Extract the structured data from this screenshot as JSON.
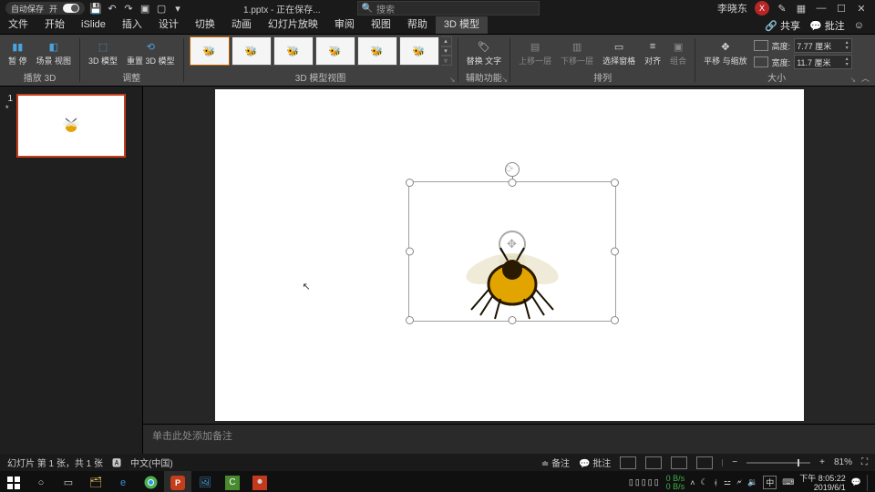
{
  "titlebar": {
    "autosave_label": "自动保存",
    "autosave_state": "开",
    "document": "1.pptx - 正在保存...",
    "search_placeholder": "搜索",
    "user_name": "李晓东",
    "user_initial": "X"
  },
  "tabs": {
    "items": [
      "文件",
      "开始",
      "iSlide",
      "插入",
      "设计",
      "切换",
      "动画",
      "幻灯片放映",
      "审阅",
      "视图",
      "帮助",
      "3D 模型"
    ],
    "active": "3D 模型",
    "share": "共享",
    "comments": "批注"
  },
  "ribbon": {
    "group_play3d": {
      "label": "播放 3D",
      "pause": "暂\n停",
      "scene": "场景\n视图"
    },
    "group_adjust": {
      "label": "调整",
      "model": "3D\n模型",
      "reset": "重置 3D\n模型"
    },
    "group_views": {
      "label": "3D 模型视图"
    },
    "group_assist": {
      "label": "辅助功能",
      "alt": "替换\n文字"
    },
    "group_arrange": {
      "label": "排列",
      "forward": "上移一层",
      "backward": "下移一层",
      "selpane": "选择窗格",
      "align": "对齐",
      "group": "组合"
    },
    "group_size": {
      "label": "大小",
      "panzoom": "平移\n与缩放",
      "height_label": "高度:",
      "height": "7.77 厘米",
      "width_label": "宽度:",
      "width": "11.7 厘米"
    }
  },
  "slide": {
    "number": "1",
    "marker": "*"
  },
  "notes": {
    "placeholder": "单击此处添加备注"
  },
  "status": {
    "slide_info": "幻灯片 第 1 张，共 1 张",
    "lang": "中文(中国)",
    "notes_btn": "备注",
    "comments_btn": "批注",
    "zoom": "81%"
  },
  "tray": {
    "net_up": "0 B/s",
    "net_down": "0 B/s",
    "ime": "中",
    "clock_time": "下午 8:05:22",
    "clock_date": "2019/6/1"
  }
}
